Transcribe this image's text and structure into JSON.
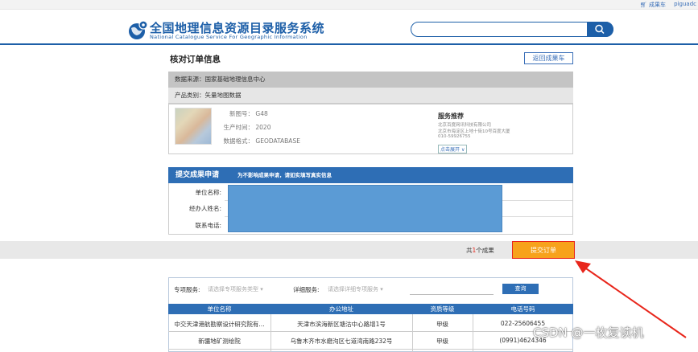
{
  "topbar": {
    "cart_label": "成果车",
    "user": "piguadc"
  },
  "header": {
    "title_cn": "全国地理信息资源目录服务系统",
    "title_en": "National Catalogue Service For Geographic Information"
  },
  "page": {
    "title": "核对订单信息",
    "back_button": "返回成果车"
  },
  "product": {
    "source": "数据来源：国家基础地理信息中心",
    "category": "产品类别：矢量地图数据",
    "fields": [
      {
        "key": "新图号：",
        "value": "G48"
      },
      {
        "key": "生产时间：",
        "value": "2020"
      },
      {
        "key": "数据格式：",
        "value": "GEODATABASE"
      }
    ]
  },
  "service_recommend": {
    "title": "服务推荐",
    "lines": [
      "北京百度网讯科技有限公司",
      "北京市海淀区上地十街10号百度大厦",
      "010-59926755"
    ],
    "expand": "点击展开"
  },
  "form": {
    "header": "提交成果申请",
    "notice": "为不影响成果申请，请如实填写真实信息",
    "labels": [
      "单位名称:",
      "经办人姓名:",
      "联系电话:"
    ]
  },
  "submit": {
    "count_prefix": "共",
    "count": "1",
    "count_suffix": "个成果",
    "button": "提交订单"
  },
  "services": {
    "type_label": "专项服务:",
    "type_placeholder": "请选择专项服务类型",
    "detail_label": "详细服务:",
    "detail_placeholder": "请选择详细专项服务",
    "query_button": "查询",
    "columns": [
      "单位名称",
      "办公地址",
      "资质等级",
      "电话号码"
    ],
    "rows": [
      [
        "中交天津港航勘察设计研究院有...",
        "天津市滨海新区塘沽中心路增1号",
        "甲级",
        "022-25606455"
      ],
      [
        "新疆地矿测绘院",
        "乌鲁木齐市水磨沟区七道湾南路232号",
        "甲级",
        "(0991)4624346"
      ]
    ]
  },
  "watermark": "CSDN @一枚复读机",
  "colors": {
    "brand": "#1d5fa8",
    "header_blue": "#2e6eb5",
    "submit_orange": "#f7a21b",
    "arrow_red": "#e8261b",
    "redaction": "#5b9bd5"
  }
}
